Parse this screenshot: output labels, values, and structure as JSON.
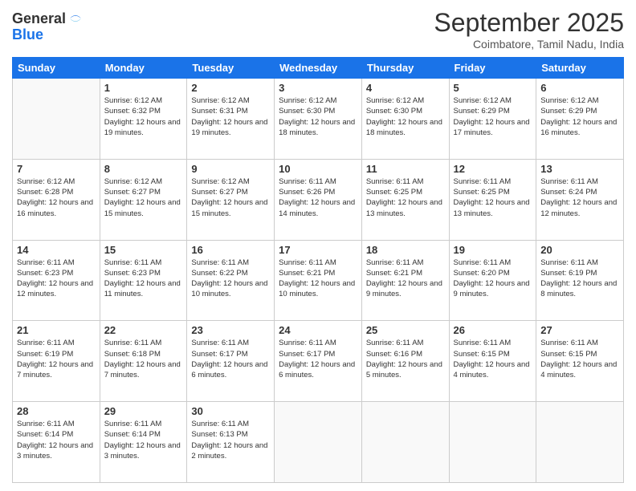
{
  "logo": {
    "line1": "General",
    "line2": "Blue"
  },
  "header": {
    "month": "September 2025",
    "location": "Coimbatore, Tamil Nadu, India"
  },
  "weekdays": [
    "Sunday",
    "Monday",
    "Tuesday",
    "Wednesday",
    "Thursday",
    "Friday",
    "Saturday"
  ],
  "weeks": [
    [
      null,
      {
        "day": "1",
        "sunrise": "6:12 AM",
        "sunset": "6:32 PM",
        "daylight": "12 hours and 19 minutes."
      },
      {
        "day": "2",
        "sunrise": "6:12 AM",
        "sunset": "6:31 PM",
        "daylight": "12 hours and 19 minutes."
      },
      {
        "day": "3",
        "sunrise": "6:12 AM",
        "sunset": "6:30 PM",
        "daylight": "12 hours and 18 minutes."
      },
      {
        "day": "4",
        "sunrise": "6:12 AM",
        "sunset": "6:30 PM",
        "daylight": "12 hours and 18 minutes."
      },
      {
        "day": "5",
        "sunrise": "6:12 AM",
        "sunset": "6:29 PM",
        "daylight": "12 hours and 17 minutes."
      },
      {
        "day": "6",
        "sunrise": "6:12 AM",
        "sunset": "6:29 PM",
        "daylight": "12 hours and 16 minutes."
      }
    ],
    [
      {
        "day": "7",
        "sunrise": "6:12 AM",
        "sunset": "6:28 PM",
        "daylight": "12 hours and 16 minutes."
      },
      {
        "day": "8",
        "sunrise": "6:12 AM",
        "sunset": "6:27 PM",
        "daylight": "12 hours and 15 minutes."
      },
      {
        "day": "9",
        "sunrise": "6:12 AM",
        "sunset": "6:27 PM",
        "daylight": "12 hours and 15 minutes."
      },
      {
        "day": "10",
        "sunrise": "6:11 AM",
        "sunset": "6:26 PM",
        "daylight": "12 hours and 14 minutes."
      },
      {
        "day": "11",
        "sunrise": "6:11 AM",
        "sunset": "6:25 PM",
        "daylight": "12 hours and 13 minutes."
      },
      {
        "day": "12",
        "sunrise": "6:11 AM",
        "sunset": "6:25 PM",
        "daylight": "12 hours and 13 minutes."
      },
      {
        "day": "13",
        "sunrise": "6:11 AM",
        "sunset": "6:24 PM",
        "daylight": "12 hours and 12 minutes."
      }
    ],
    [
      {
        "day": "14",
        "sunrise": "6:11 AM",
        "sunset": "6:23 PM",
        "daylight": "12 hours and 12 minutes."
      },
      {
        "day": "15",
        "sunrise": "6:11 AM",
        "sunset": "6:23 PM",
        "daylight": "12 hours and 11 minutes."
      },
      {
        "day": "16",
        "sunrise": "6:11 AM",
        "sunset": "6:22 PM",
        "daylight": "12 hours and 10 minutes."
      },
      {
        "day": "17",
        "sunrise": "6:11 AM",
        "sunset": "6:21 PM",
        "daylight": "12 hours and 10 minutes."
      },
      {
        "day": "18",
        "sunrise": "6:11 AM",
        "sunset": "6:21 PM",
        "daylight": "12 hours and 9 minutes."
      },
      {
        "day": "19",
        "sunrise": "6:11 AM",
        "sunset": "6:20 PM",
        "daylight": "12 hours and 9 minutes."
      },
      {
        "day": "20",
        "sunrise": "6:11 AM",
        "sunset": "6:19 PM",
        "daylight": "12 hours and 8 minutes."
      }
    ],
    [
      {
        "day": "21",
        "sunrise": "6:11 AM",
        "sunset": "6:19 PM",
        "daylight": "12 hours and 7 minutes."
      },
      {
        "day": "22",
        "sunrise": "6:11 AM",
        "sunset": "6:18 PM",
        "daylight": "12 hours and 7 minutes."
      },
      {
        "day": "23",
        "sunrise": "6:11 AM",
        "sunset": "6:17 PM",
        "daylight": "12 hours and 6 minutes."
      },
      {
        "day": "24",
        "sunrise": "6:11 AM",
        "sunset": "6:17 PM",
        "daylight": "12 hours and 6 minutes."
      },
      {
        "day": "25",
        "sunrise": "6:11 AM",
        "sunset": "6:16 PM",
        "daylight": "12 hours and 5 minutes."
      },
      {
        "day": "26",
        "sunrise": "6:11 AM",
        "sunset": "6:15 PM",
        "daylight": "12 hours and 4 minutes."
      },
      {
        "day": "27",
        "sunrise": "6:11 AM",
        "sunset": "6:15 PM",
        "daylight": "12 hours and 4 minutes."
      }
    ],
    [
      {
        "day": "28",
        "sunrise": "6:11 AM",
        "sunset": "6:14 PM",
        "daylight": "12 hours and 3 minutes."
      },
      {
        "day": "29",
        "sunrise": "6:11 AM",
        "sunset": "6:14 PM",
        "daylight": "12 hours and 3 minutes."
      },
      {
        "day": "30",
        "sunrise": "6:11 AM",
        "sunset": "6:13 PM",
        "daylight": "12 hours and 2 minutes."
      },
      null,
      null,
      null,
      null
    ]
  ]
}
